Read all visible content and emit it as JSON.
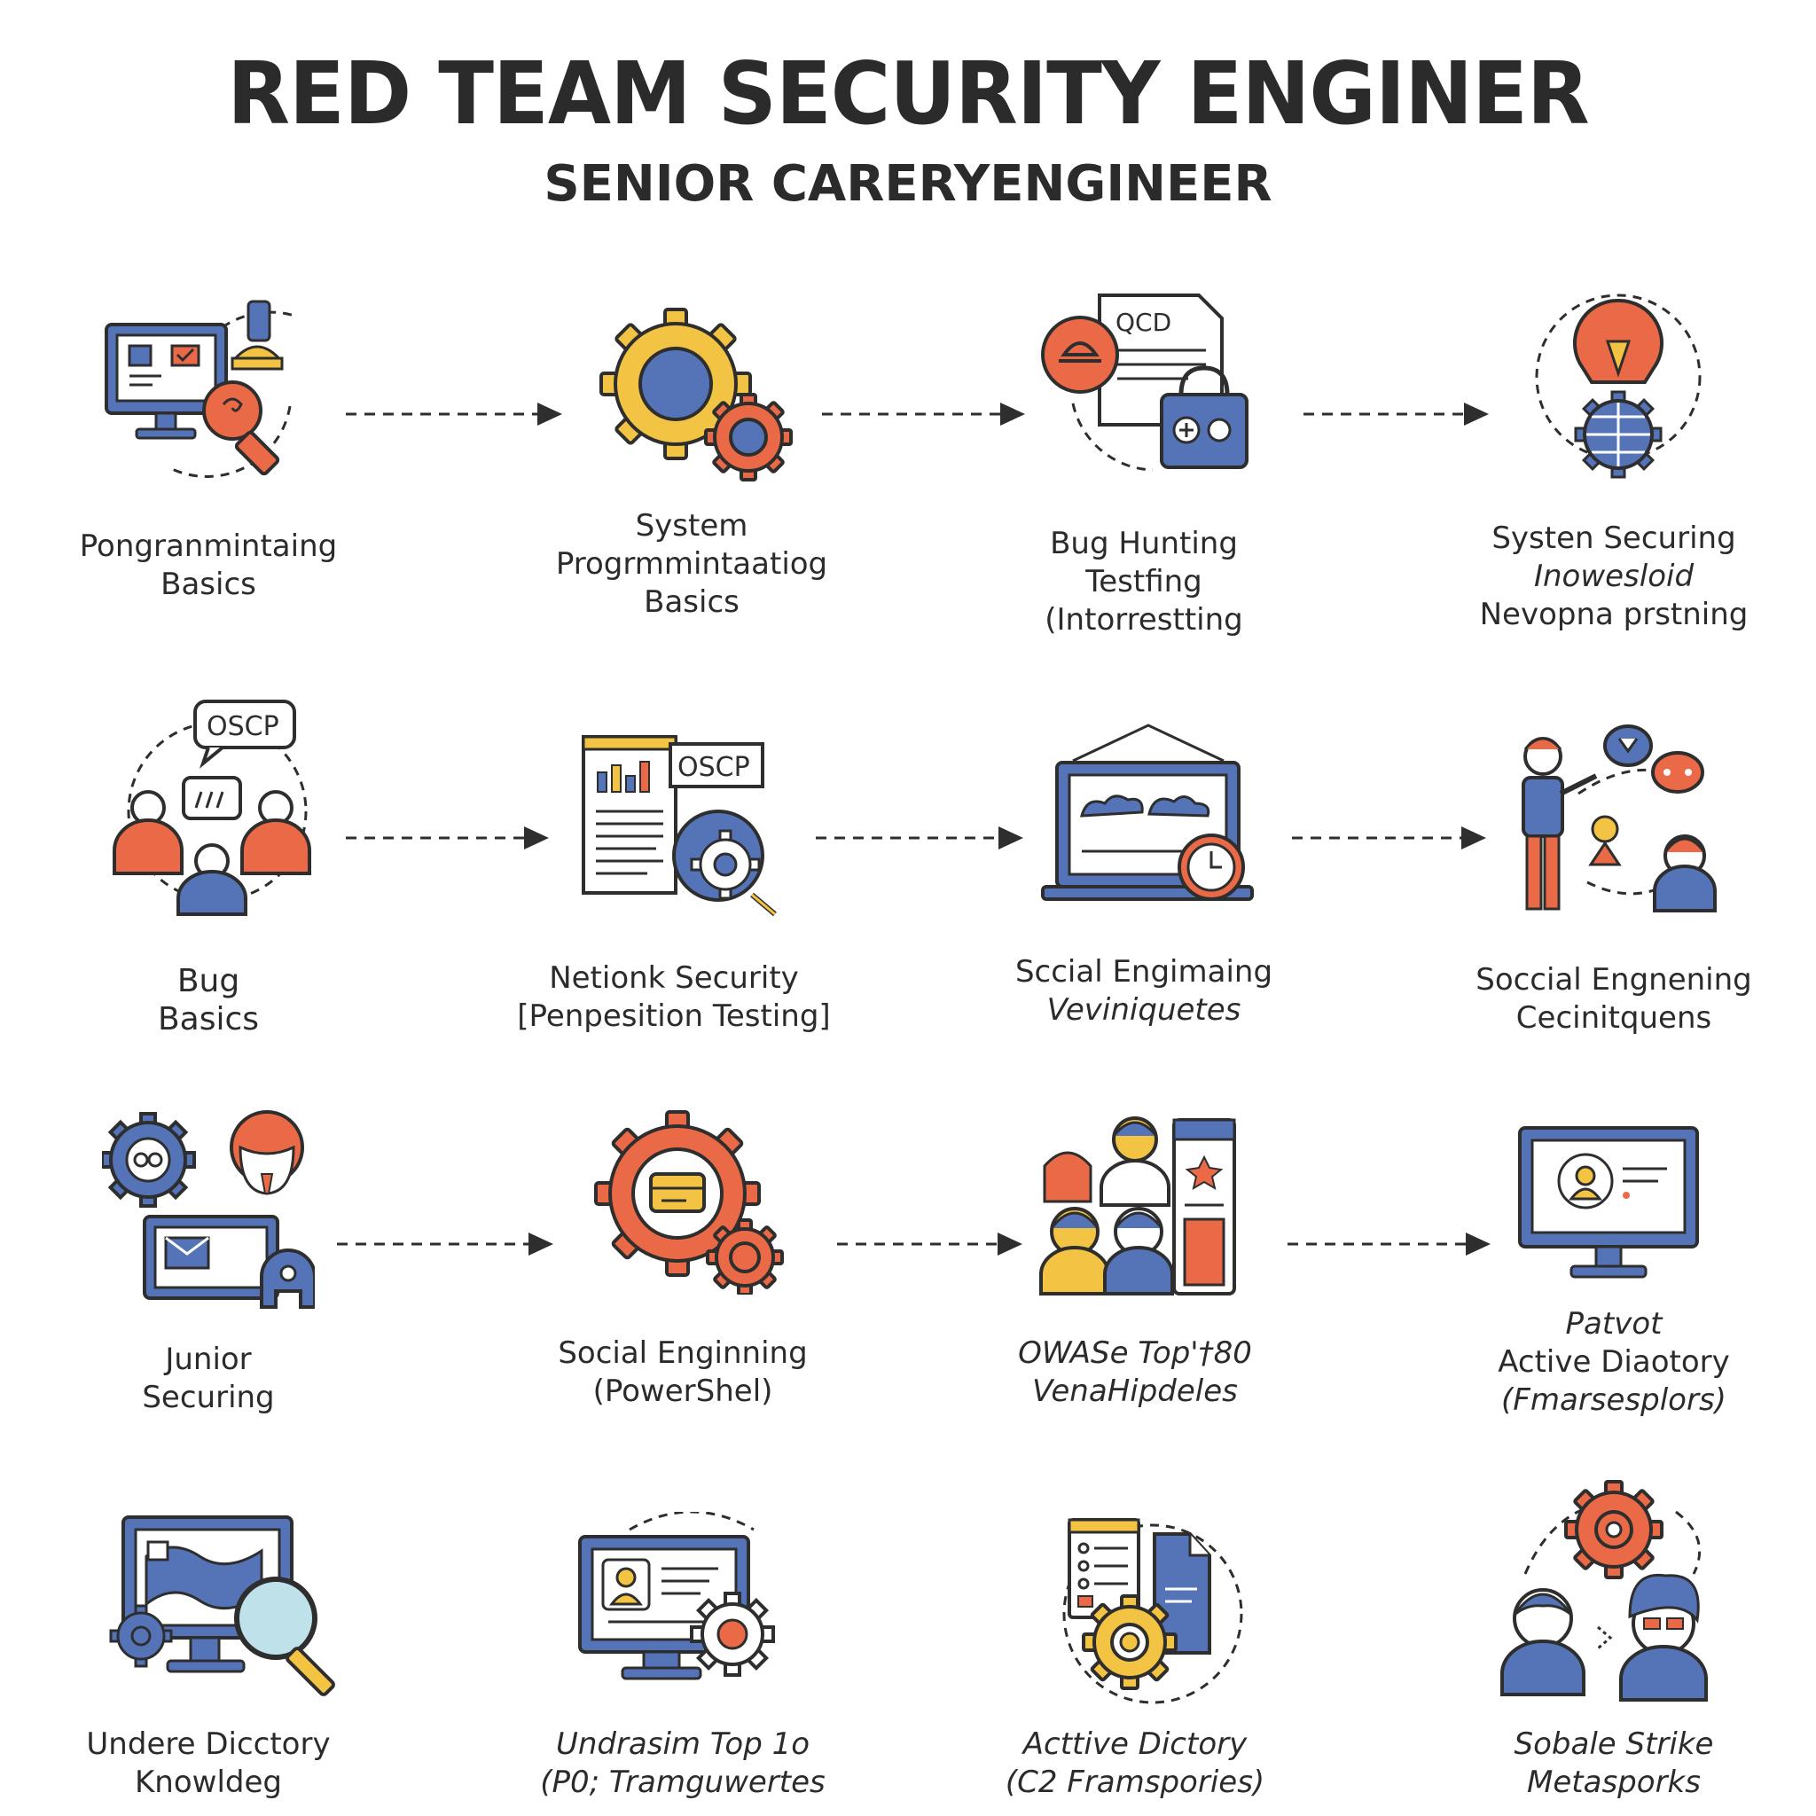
{
  "header": {
    "title": "RED TEAM SECURITY ENGINER",
    "subtitle": "SENIOR CARERYENGINEER"
  },
  "colors": {
    "blue": "#5574b8",
    "orange": "#ea6a47",
    "yellow": "#f3c443",
    "outline": "#2e2e2e"
  },
  "rows": [
    {
      "nodes": [
        {
          "icon": "computer-magnifier-icon",
          "lines": [
            "Pongranmintaing",
            "Basics"
          ]
        },
        {
          "icon": "gears-icon",
          "lines": [
            "System",
            "Progrmmintaatiog",
            "Basics"
          ]
        },
        {
          "icon": "document-lock-icon",
          "doc_text": "QCD",
          "lines": [
            "Bug Hunting",
            "Testfing",
            "(Intorrestting"
          ]
        },
        {
          "icon": "lightbulb-globe-icon",
          "lines": [
            "Systen Securing",
            "Inowesloid",
            "Nevopna prstning"
          ]
        }
      ]
    },
    {
      "nodes": [
        {
          "icon": "team-chat-icon",
          "bubble_text": "OSCP",
          "lines": [
            "Bug",
            "Basics"
          ]
        },
        {
          "icon": "report-gear-icon",
          "badge_text": "OSCP",
          "lines": [
            "Netionk Security",
            "[Penpesition Testing]"
          ]
        },
        {
          "icon": "laptop-clock-icon",
          "lines": [
            "Sccial Engimaing",
            "Veviniquetes"
          ]
        },
        {
          "icon": "presenter-people-icon",
          "lines": [
            "Soccial Engnening",
            "Cecinitquens"
          ]
        }
      ]
    },
    {
      "nodes": [
        {
          "icon": "gear-person-shield-icon",
          "lines": [
            "Junior",
            "Securing"
          ]
        },
        {
          "icon": "gear-card-icon",
          "lines": [
            "Social Enginning",
            "(PowerShel)"
          ]
        },
        {
          "icon": "people-browser-icon",
          "lines": [
            "OWASe Top'†80",
            "VenaHipdeles"
          ]
        },
        {
          "icon": "monitor-user-icon",
          "lines": [
            "Patvot",
            "Active Diaotory",
            "(Fmarsesplors)"
          ]
        }
      ]
    },
    {
      "nodes": [
        {
          "icon": "monitor-map-magnifier-icon",
          "lines": [
            "Undere Dicctory",
            "Knowldeg"
          ]
        },
        {
          "icon": "monitor-profile-gear-icon",
          "lines": [
            "Undrasim Top 1o",
            "(P0; Tramguwertes"
          ]
        },
        {
          "icon": "checklist-folder-gear-icon",
          "lines": [
            "Acttive Dictory",
            "(C2 Framspories)"
          ]
        },
        {
          "icon": "people-gear-icon",
          "lines": [
            "Sobale Strike",
            "Metasporks"
          ]
        }
      ]
    }
  ]
}
